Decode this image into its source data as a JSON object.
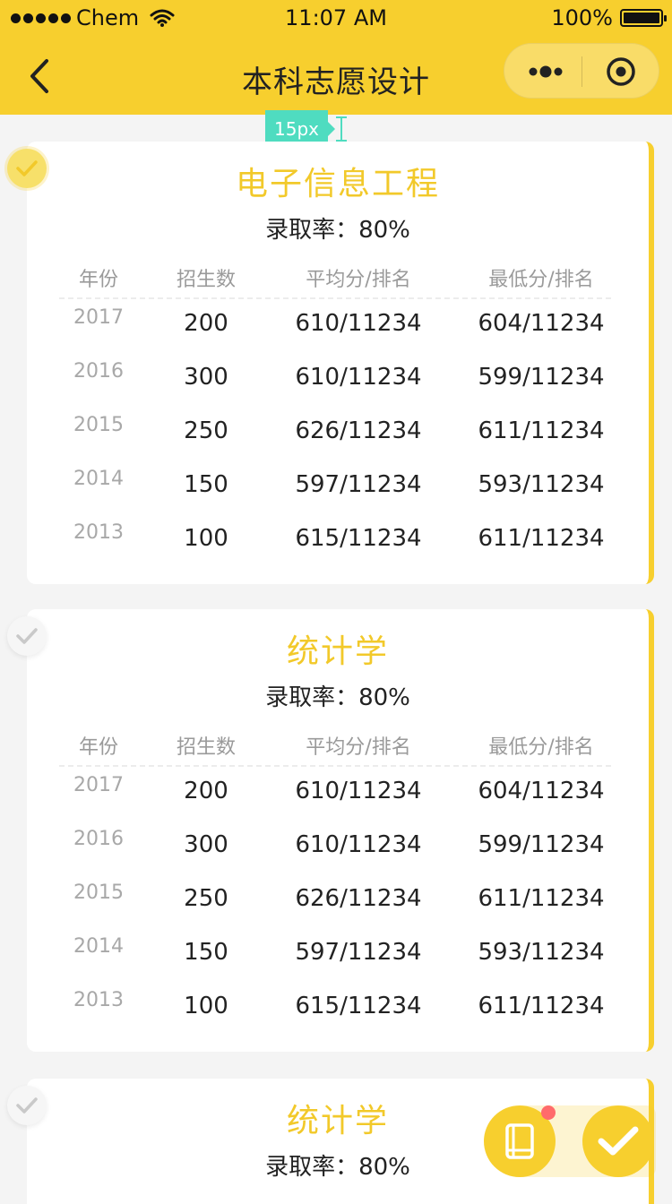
{
  "status": {
    "carrier": "Chem",
    "time": "11:07 AM",
    "battery": "100%"
  },
  "nav": {
    "title": "本科志愿设计"
  },
  "measure_tag": "15px",
  "table_headers": [
    "年份",
    "招生数",
    "平均分/排名",
    "最低分/排名"
  ],
  "cards": [
    {
      "title": "电子信息工程",
      "rate": "录取率：80%",
      "selected": true,
      "rows": [
        [
          "2017",
          "200",
          "610/11234",
          "604/11234"
        ],
        [
          "2016",
          "300",
          "610/11234",
          "599/11234"
        ],
        [
          "2015",
          "250",
          "626/11234",
          "611/11234"
        ],
        [
          "2014",
          "150",
          "597/11234",
          "593/11234"
        ],
        [
          "2013",
          "100",
          "615/11234",
          "611/11234"
        ]
      ]
    },
    {
      "title": "统计学",
      "rate": "录取率：80%",
      "selected": false,
      "rows": [
        [
          "2017",
          "200",
          "610/11234",
          "604/11234"
        ],
        [
          "2016",
          "300",
          "610/11234",
          "599/11234"
        ],
        [
          "2015",
          "250",
          "626/11234",
          "611/11234"
        ],
        [
          "2014",
          "150",
          "597/11234",
          "593/11234"
        ],
        [
          "2013",
          "100",
          "615/11234",
          "611/11234"
        ]
      ]
    },
    {
      "title": "统计学",
      "rate": "录取率：80%",
      "selected": false,
      "rows": []
    }
  ],
  "colors": {
    "accent": "#f7cf2e",
    "title_yellow": "#f2c92a",
    "measure": "#4fdcc0",
    "badge": "#ff6b6b"
  },
  "icons": {
    "back": "chevron-left-icon",
    "more": "more-dots-icon",
    "close": "target-close-icon",
    "check": "check-icon",
    "book": "book-icon",
    "confirm": "checkmark-icon",
    "wifi": "wifi-icon",
    "battery": "battery-icon"
  }
}
